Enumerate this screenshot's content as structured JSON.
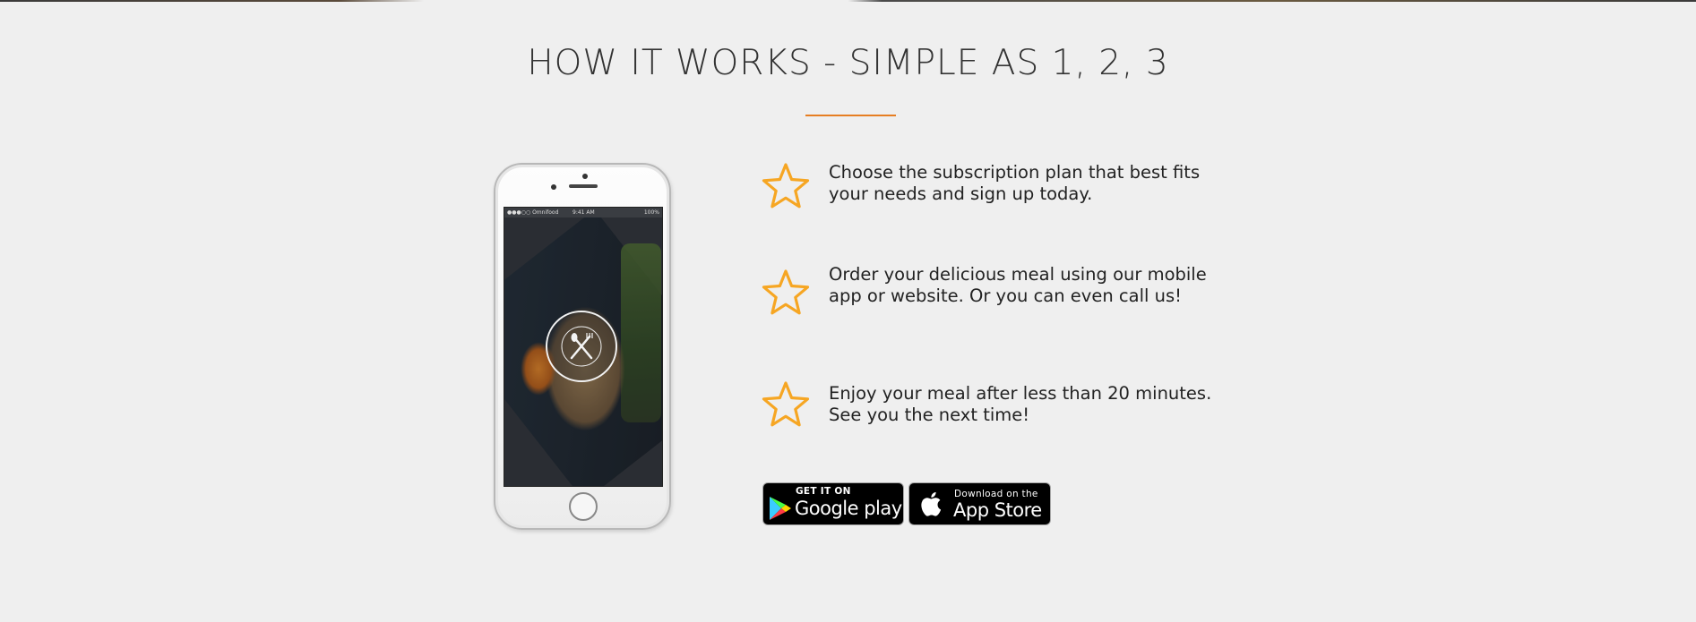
{
  "section": {
    "title": "HOW IT WORKS - SIMPLE AS 1, 2, 3"
  },
  "colors": {
    "accent": "#e67e22",
    "star": "#f6a623",
    "background": "#efefef",
    "text": "#222222"
  },
  "phone": {
    "status_carrier": "●●●○○ Omnifood",
    "status_time": "9:41 AM",
    "status_battery": "100%",
    "app_logo_icon": "fork-spoon-logo-icon"
  },
  "steps": [
    {
      "icon": "star-icon",
      "text": "Choose the subscription plan that best fits your needs and sign up today."
    },
    {
      "icon": "star-icon",
      "text": "Order your delicious meal using our mobile app or website. Or you can even call us!"
    },
    {
      "icon": "star-icon",
      "text": "Enjoy your meal after less than 20 minutes. See you the next time!"
    }
  ],
  "badges": {
    "google": {
      "small": "GET IT ON",
      "big": "Google play"
    },
    "apple": {
      "small": "Download on the",
      "big": "App Store"
    }
  }
}
